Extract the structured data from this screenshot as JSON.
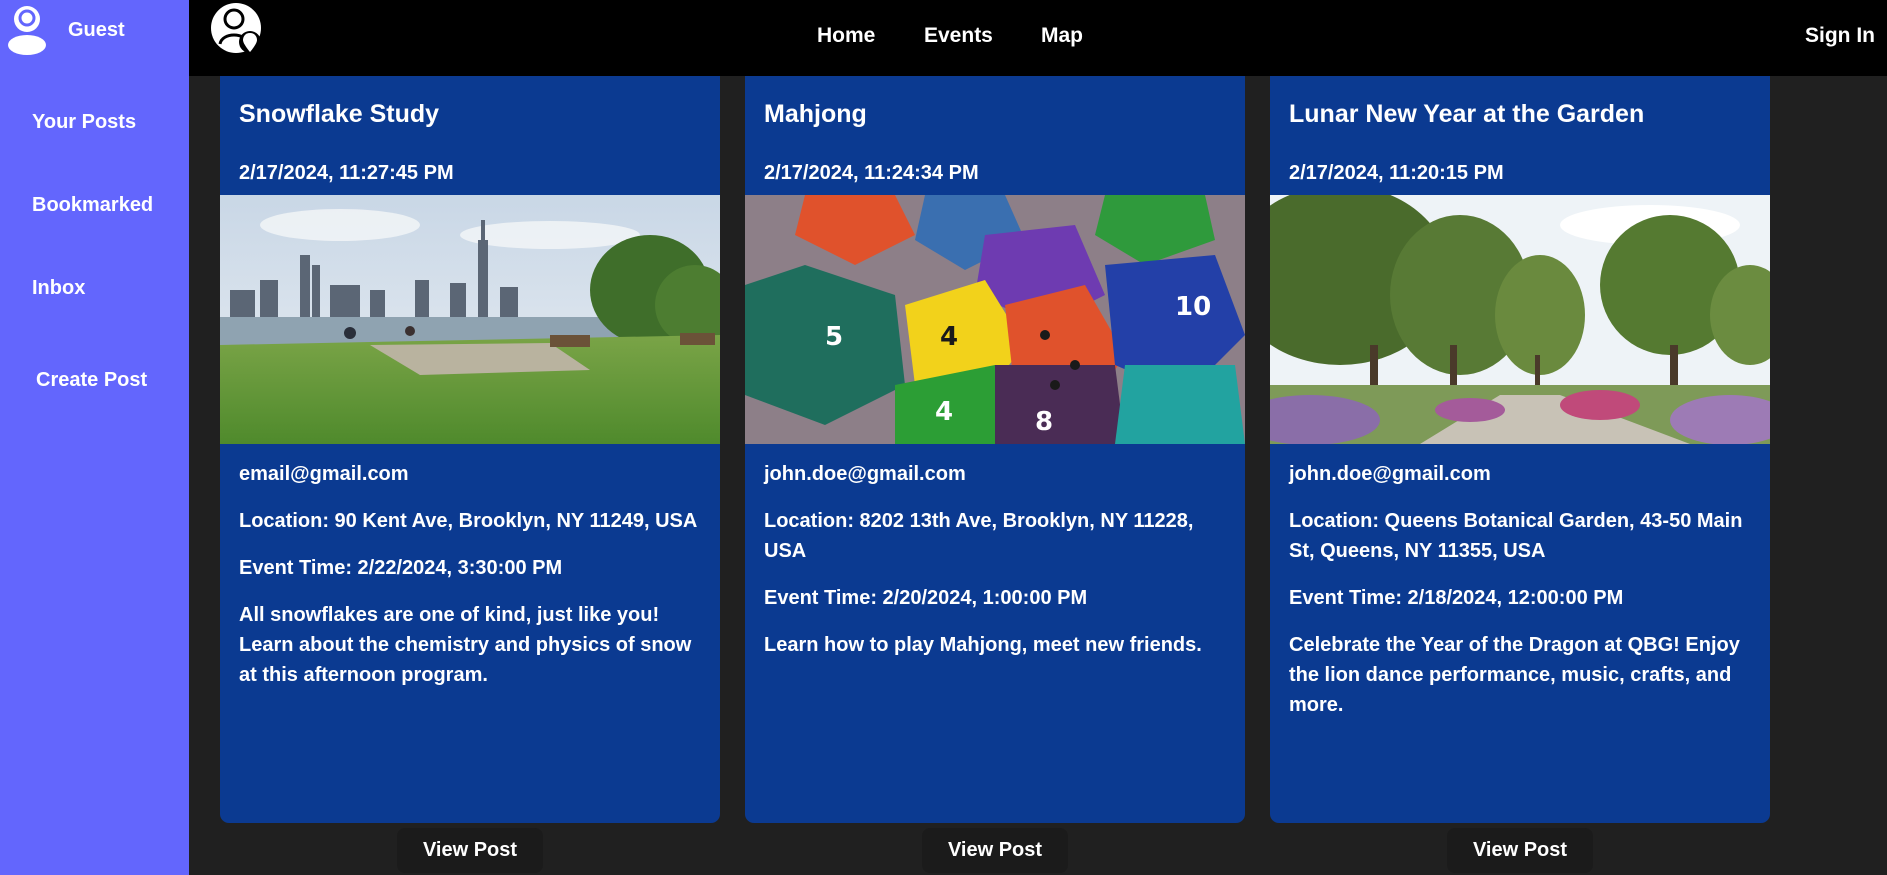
{
  "sidebar": {
    "user_label": "Guest",
    "items": [
      {
        "label": "Your Posts"
      },
      {
        "label": "Bookmarked"
      },
      {
        "label": "Inbox"
      },
      {
        "label": "Create Post"
      }
    ]
  },
  "topbar": {
    "nav": [
      {
        "label": "Home"
      },
      {
        "label": "Events"
      },
      {
        "label": "Map"
      }
    ],
    "sign_in_label": "Sign In"
  },
  "posts": [
    {
      "title": "Snowflake Study",
      "posted": "2/17/2024, 11:27:45 PM",
      "image_icon": "waterfront-skyline-photo",
      "author": "email@gmail.com",
      "location": "Location: 90 Kent Ave, Brooklyn, NY 11249, USA",
      "event_time": "Event Time: 2/22/2024, 3:30:00 PM",
      "description": "All snowflakes are one of kind, just like you! Learn about the chemistry and physics of snow at this afternoon program.",
      "button_label": "View Post"
    },
    {
      "title": "Mahjong",
      "posted": "2/17/2024, 11:24:34 PM",
      "image_icon": "colorful-dice-photo",
      "author": "john.doe@gmail.com",
      "location": "Location: 8202 13th Ave, Brooklyn, NY 11228, USA",
      "event_time": "Event Time: 2/20/2024, 1:00:00 PM",
      "description": "Learn how to play Mahjong, meet new friends.",
      "button_label": "View Post"
    },
    {
      "title": "Lunar New Year at the Garden",
      "posted": "2/17/2024, 11:20:15 PM",
      "image_icon": "botanical-garden-photo",
      "author": "john.doe@gmail.com",
      "location": "Location: Queens Botanical Garden, 43-50 Main St, Queens, NY 11355, USA",
      "event_time": "Event Time: 2/18/2024, 12:00:00 PM",
      "description": "Celebrate the Year of the Dragon at QBG! Enjoy the lion dance performance, music, crafts, and more.",
      "button_label": "View Post"
    }
  ],
  "colors": {
    "sidebar": "#6366fd",
    "topbar": "#000000",
    "page_background": "#202020",
    "card": "#0b3a91",
    "button": "#1b1b1b"
  }
}
